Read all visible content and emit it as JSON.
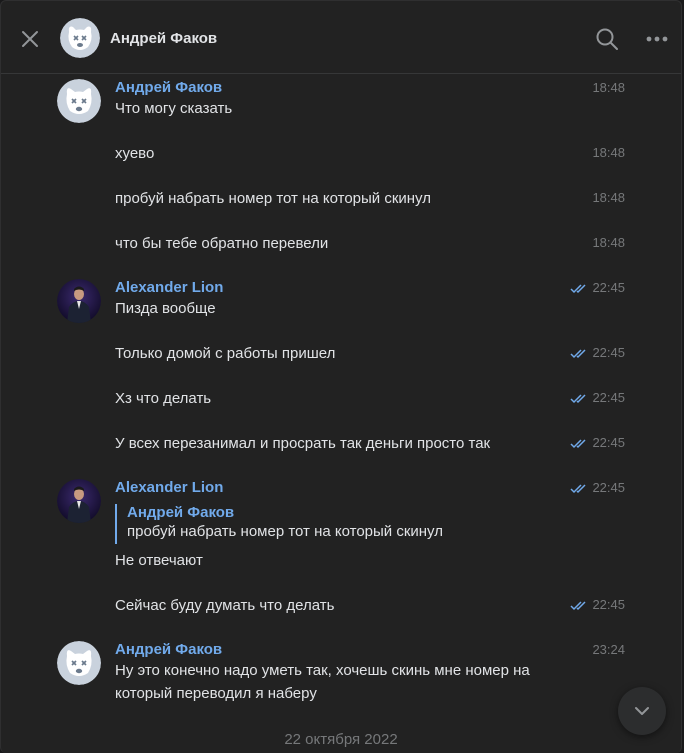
{
  "header": {
    "title": "Андрей Факов"
  },
  "colors": {
    "accent": "#71aaeb",
    "text": "#e1e3e6",
    "muted": "#76787a",
    "background": "#222222"
  },
  "messages": [
    {
      "author": "Андрей Факов",
      "text": "Что могу сказать",
      "time": "18:48"
    },
    {
      "text": "хуево",
      "time": "18:48"
    },
    {
      "text": "пробуй набрать номер тот на который скинул",
      "time": "18:48"
    },
    {
      "text": "что бы тебе обратно перевели",
      "time": "18:48"
    },
    {
      "author": "Alexander Lion",
      "text": "Пизда вообще",
      "time": "22:45"
    },
    {
      "text": "Только домой с работы пришел",
      "time": "22:45"
    },
    {
      "text": "Хз что делать",
      "time": "22:45"
    },
    {
      "text": "У всех перезанимал и просрать так деньги просто так",
      "time": "22:45"
    },
    {
      "author": "Alexander Lion",
      "reply_author": "Андрей Факов",
      "reply_text": "пробуй набрать номер тот на который скинул",
      "text": "Не отвечают",
      "time": "22:45"
    },
    {
      "text": "Сейчас буду думать что делать",
      "time": "22:45"
    },
    {
      "author": "Андрей Факов",
      "text_line1": "Ну это конечно надо уметь так, хочешь скинь мне номер на",
      "text_line2": "который переводил я наберу",
      "time": "23:24"
    }
  ],
  "date_separator": "22 октября 2022",
  "icons": [
    "close-icon",
    "search-icon",
    "more-icon",
    "read-ticks-icon",
    "chevron-down-icon"
  ]
}
